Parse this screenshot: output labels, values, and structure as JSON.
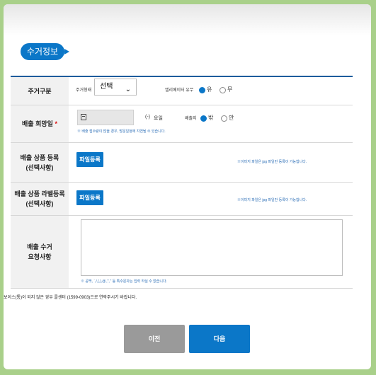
{
  "section_title": "수거정보",
  "rows": {
    "type": {
      "label": "주거구분",
      "sublabel": "주거형태",
      "select_value": "선택",
      "elevator_label": "엘리베이터 유무",
      "options": [
        "유",
        "무"
      ]
    },
    "date": {
      "label": "배출 희망일",
      "required_mark": "*",
      "weekday_prefix": "(-)",
      "weekday_suffix": "요일",
      "place_label": "배출지",
      "options": [
        "밖",
        "안"
      ],
      "note": "※ 배출 접수량이 많을 경우, 방문일정에 지연될 수 있습니다."
    },
    "photo1": {
      "label": "배출 상품 등록",
      "label2": "(선택사항)",
      "button": "파일등록",
      "note": "※이미지 파일은 jpg 파일만 등록이 가능합니다."
    },
    "photo2": {
      "label": "배출 상품 라벨등록",
      "label2": "(선택사항)",
      "button": "파일등록",
      "note": "※이미지 파일은 jpg 파일만 등록이 가능합니다."
    },
    "request": {
      "label": "배출 수거",
      "label2": "요청사항",
      "note": "※ 공백, `,/,(,),@,',',\" 등 특수문자는 입력 하실 수 없습니다."
    }
  },
  "notice": "보이스(통)이 되지 않은 경우 콜센터 (1599-0903)으로 연락주시기 바랍니다.",
  "buttons": {
    "prev": "이전",
    "next": "다음"
  }
}
